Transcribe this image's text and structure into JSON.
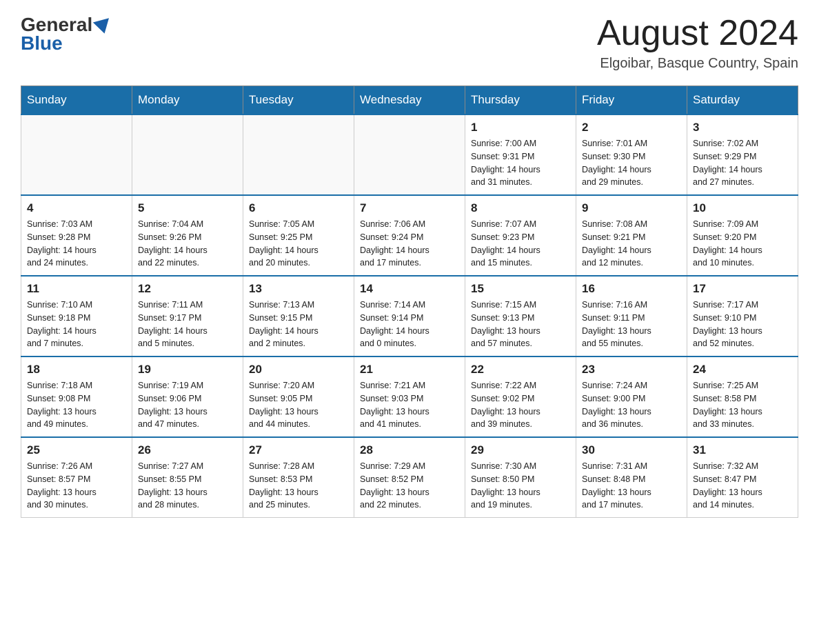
{
  "header": {
    "logo_general": "General",
    "logo_blue": "Blue",
    "month_year": "August 2024",
    "location": "Elgoibar, Basque Country, Spain"
  },
  "days_of_week": [
    "Sunday",
    "Monday",
    "Tuesday",
    "Wednesday",
    "Thursday",
    "Friday",
    "Saturday"
  ],
  "weeks": [
    [
      {
        "day": "",
        "info": ""
      },
      {
        "day": "",
        "info": ""
      },
      {
        "day": "",
        "info": ""
      },
      {
        "day": "",
        "info": ""
      },
      {
        "day": "1",
        "info": "Sunrise: 7:00 AM\nSunset: 9:31 PM\nDaylight: 14 hours\nand 31 minutes."
      },
      {
        "day": "2",
        "info": "Sunrise: 7:01 AM\nSunset: 9:30 PM\nDaylight: 14 hours\nand 29 minutes."
      },
      {
        "day": "3",
        "info": "Sunrise: 7:02 AM\nSunset: 9:29 PM\nDaylight: 14 hours\nand 27 minutes."
      }
    ],
    [
      {
        "day": "4",
        "info": "Sunrise: 7:03 AM\nSunset: 9:28 PM\nDaylight: 14 hours\nand 24 minutes."
      },
      {
        "day": "5",
        "info": "Sunrise: 7:04 AM\nSunset: 9:26 PM\nDaylight: 14 hours\nand 22 minutes."
      },
      {
        "day": "6",
        "info": "Sunrise: 7:05 AM\nSunset: 9:25 PM\nDaylight: 14 hours\nand 20 minutes."
      },
      {
        "day": "7",
        "info": "Sunrise: 7:06 AM\nSunset: 9:24 PM\nDaylight: 14 hours\nand 17 minutes."
      },
      {
        "day": "8",
        "info": "Sunrise: 7:07 AM\nSunset: 9:23 PM\nDaylight: 14 hours\nand 15 minutes."
      },
      {
        "day": "9",
        "info": "Sunrise: 7:08 AM\nSunset: 9:21 PM\nDaylight: 14 hours\nand 12 minutes."
      },
      {
        "day": "10",
        "info": "Sunrise: 7:09 AM\nSunset: 9:20 PM\nDaylight: 14 hours\nand 10 minutes."
      }
    ],
    [
      {
        "day": "11",
        "info": "Sunrise: 7:10 AM\nSunset: 9:18 PM\nDaylight: 14 hours\nand 7 minutes."
      },
      {
        "day": "12",
        "info": "Sunrise: 7:11 AM\nSunset: 9:17 PM\nDaylight: 14 hours\nand 5 minutes."
      },
      {
        "day": "13",
        "info": "Sunrise: 7:13 AM\nSunset: 9:15 PM\nDaylight: 14 hours\nand 2 minutes."
      },
      {
        "day": "14",
        "info": "Sunrise: 7:14 AM\nSunset: 9:14 PM\nDaylight: 14 hours\nand 0 minutes."
      },
      {
        "day": "15",
        "info": "Sunrise: 7:15 AM\nSunset: 9:13 PM\nDaylight: 13 hours\nand 57 minutes."
      },
      {
        "day": "16",
        "info": "Sunrise: 7:16 AM\nSunset: 9:11 PM\nDaylight: 13 hours\nand 55 minutes."
      },
      {
        "day": "17",
        "info": "Sunrise: 7:17 AM\nSunset: 9:10 PM\nDaylight: 13 hours\nand 52 minutes."
      }
    ],
    [
      {
        "day": "18",
        "info": "Sunrise: 7:18 AM\nSunset: 9:08 PM\nDaylight: 13 hours\nand 49 minutes."
      },
      {
        "day": "19",
        "info": "Sunrise: 7:19 AM\nSunset: 9:06 PM\nDaylight: 13 hours\nand 47 minutes."
      },
      {
        "day": "20",
        "info": "Sunrise: 7:20 AM\nSunset: 9:05 PM\nDaylight: 13 hours\nand 44 minutes."
      },
      {
        "day": "21",
        "info": "Sunrise: 7:21 AM\nSunset: 9:03 PM\nDaylight: 13 hours\nand 41 minutes."
      },
      {
        "day": "22",
        "info": "Sunrise: 7:22 AM\nSunset: 9:02 PM\nDaylight: 13 hours\nand 39 minutes."
      },
      {
        "day": "23",
        "info": "Sunrise: 7:24 AM\nSunset: 9:00 PM\nDaylight: 13 hours\nand 36 minutes."
      },
      {
        "day": "24",
        "info": "Sunrise: 7:25 AM\nSunset: 8:58 PM\nDaylight: 13 hours\nand 33 minutes."
      }
    ],
    [
      {
        "day": "25",
        "info": "Sunrise: 7:26 AM\nSunset: 8:57 PM\nDaylight: 13 hours\nand 30 minutes."
      },
      {
        "day": "26",
        "info": "Sunrise: 7:27 AM\nSunset: 8:55 PM\nDaylight: 13 hours\nand 28 minutes."
      },
      {
        "day": "27",
        "info": "Sunrise: 7:28 AM\nSunset: 8:53 PM\nDaylight: 13 hours\nand 25 minutes."
      },
      {
        "day": "28",
        "info": "Sunrise: 7:29 AM\nSunset: 8:52 PM\nDaylight: 13 hours\nand 22 minutes."
      },
      {
        "day": "29",
        "info": "Sunrise: 7:30 AM\nSunset: 8:50 PM\nDaylight: 13 hours\nand 19 minutes."
      },
      {
        "day": "30",
        "info": "Sunrise: 7:31 AM\nSunset: 8:48 PM\nDaylight: 13 hours\nand 17 minutes."
      },
      {
        "day": "31",
        "info": "Sunrise: 7:32 AM\nSunset: 8:47 PM\nDaylight: 13 hours\nand 14 minutes."
      }
    ]
  ]
}
